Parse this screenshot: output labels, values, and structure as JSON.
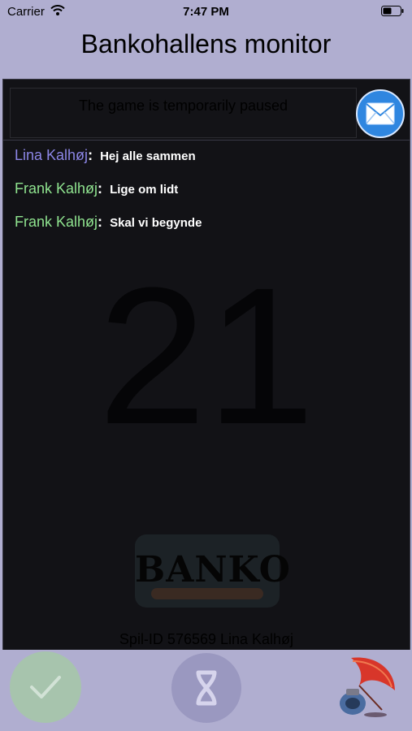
{
  "status_bar": {
    "carrier": "Carrier",
    "time": "7:47 PM"
  },
  "header": {
    "title": "Bankohallens monitor"
  },
  "banner": {
    "text": "The game is temporarily paused"
  },
  "chat": {
    "messages": [
      {
        "name": "Lina Kalhøj",
        "text": "Hej alle sammen",
        "color": "#8c86e6"
      },
      {
        "name": "Frank Kalhøj",
        "text": "Lige om lidt",
        "color": "#8fe38f"
      },
      {
        "name": "Frank Kalhøj",
        "text": "Skal vi begynde",
        "color": "#8fe38f"
      }
    ]
  },
  "current_number": "21",
  "logo": {
    "text": "BANKO"
  },
  "game_id": "Spil-ID 576569 Lina Kalhøj",
  "icons": {
    "mail": "envelope-icon",
    "confirm": "checkmark-icon",
    "loop": "infinity-icon",
    "quill": "quill-ink-icon"
  },
  "colors": {
    "background": "#b0aed0",
    "monitor": "#121216",
    "mail_button": "#2f86e0"
  }
}
